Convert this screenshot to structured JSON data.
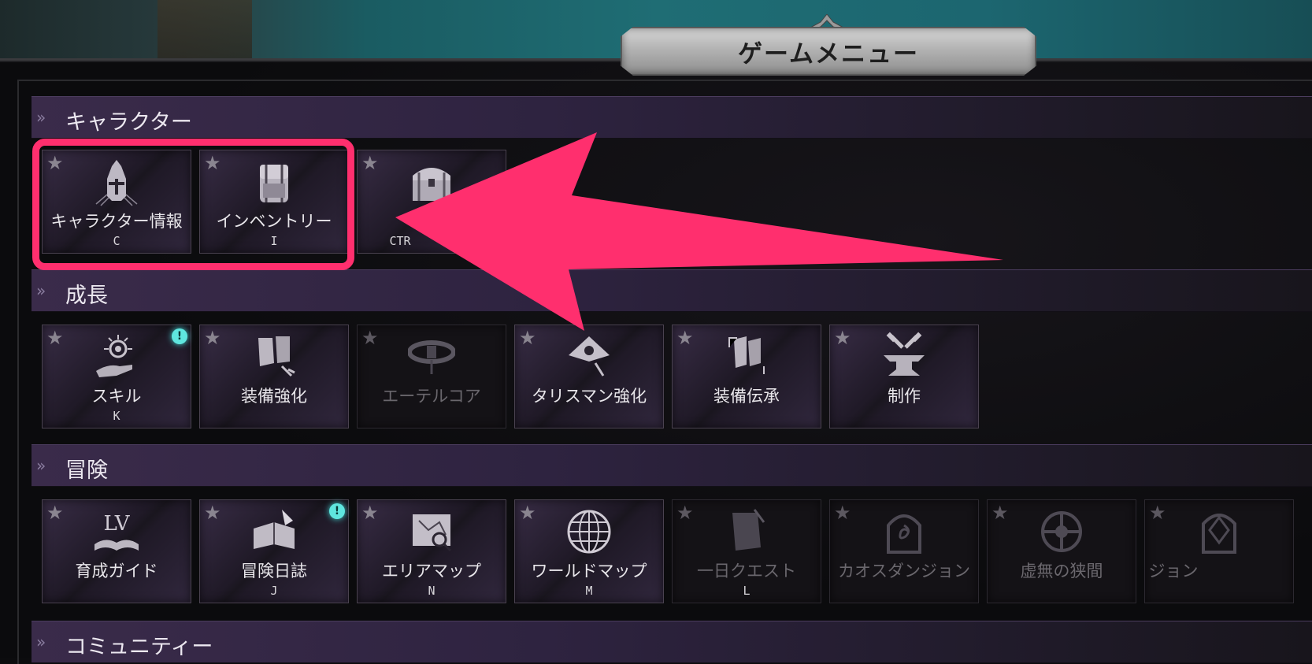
{
  "menu_title": "ゲームメニュー",
  "sections": {
    "character": {
      "label": "キャラクター",
      "items": [
        {
          "name": "キャラクター情報",
          "key": "C",
          "icon": "helmet-icon"
        },
        {
          "name": "インベントリー",
          "key": "I",
          "icon": "backpack-icon"
        },
        {
          "name": "",
          "key": "CTR",
          "icon": "chest-icon"
        }
      ]
    },
    "growth": {
      "label": "成長",
      "items": [
        {
          "name": "スキル",
          "key": "K",
          "icon": "skill-hand-icon",
          "alert": "!"
        },
        {
          "name": "装備強化",
          "key": "",
          "icon": "gauntlet-icon"
        },
        {
          "name": "エーテルコア",
          "key": "",
          "icon": "belt-icon",
          "disabled": true
        },
        {
          "name": "タリスマン強化",
          "key": "",
          "icon": "talisman-icon"
        },
        {
          "name": "装備伝承",
          "key": "",
          "icon": "armor-transfer-icon"
        },
        {
          "name": "制作",
          "key": "",
          "icon": "anvil-icon"
        }
      ]
    },
    "adventure": {
      "label": "冒険",
      "items": [
        {
          "name": "育成ガイド",
          "key": "",
          "icon": "level-book-icon",
          "icon_text": "LV"
        },
        {
          "name": "冒険日誌",
          "key": "J",
          "icon": "journal-icon",
          "alert": "!"
        },
        {
          "name": "エリアマップ",
          "key": "N",
          "icon": "area-map-icon"
        },
        {
          "name": "ワールドマップ",
          "key": "M",
          "icon": "globe-icon"
        },
        {
          "name": "一日クエスト",
          "key": "L",
          "icon": "scroll-icon",
          "disabled": true
        },
        {
          "name": "カオスダンジョン",
          "key": "",
          "icon": "chaos-gate-icon",
          "disabled": true
        },
        {
          "name": "虚無の狭間",
          "key": "",
          "icon": "void-icon",
          "disabled": true
        },
        {
          "name": "ジョン",
          "key": "",
          "icon": "dungeon-gate-icon",
          "disabled": true
        }
      ]
    },
    "community": {
      "label": "コミュニティー"
    }
  },
  "colors": {
    "highlight": "#ff2f6e",
    "section_header": "#3a2b4a",
    "alert": "#5fe6df"
  }
}
